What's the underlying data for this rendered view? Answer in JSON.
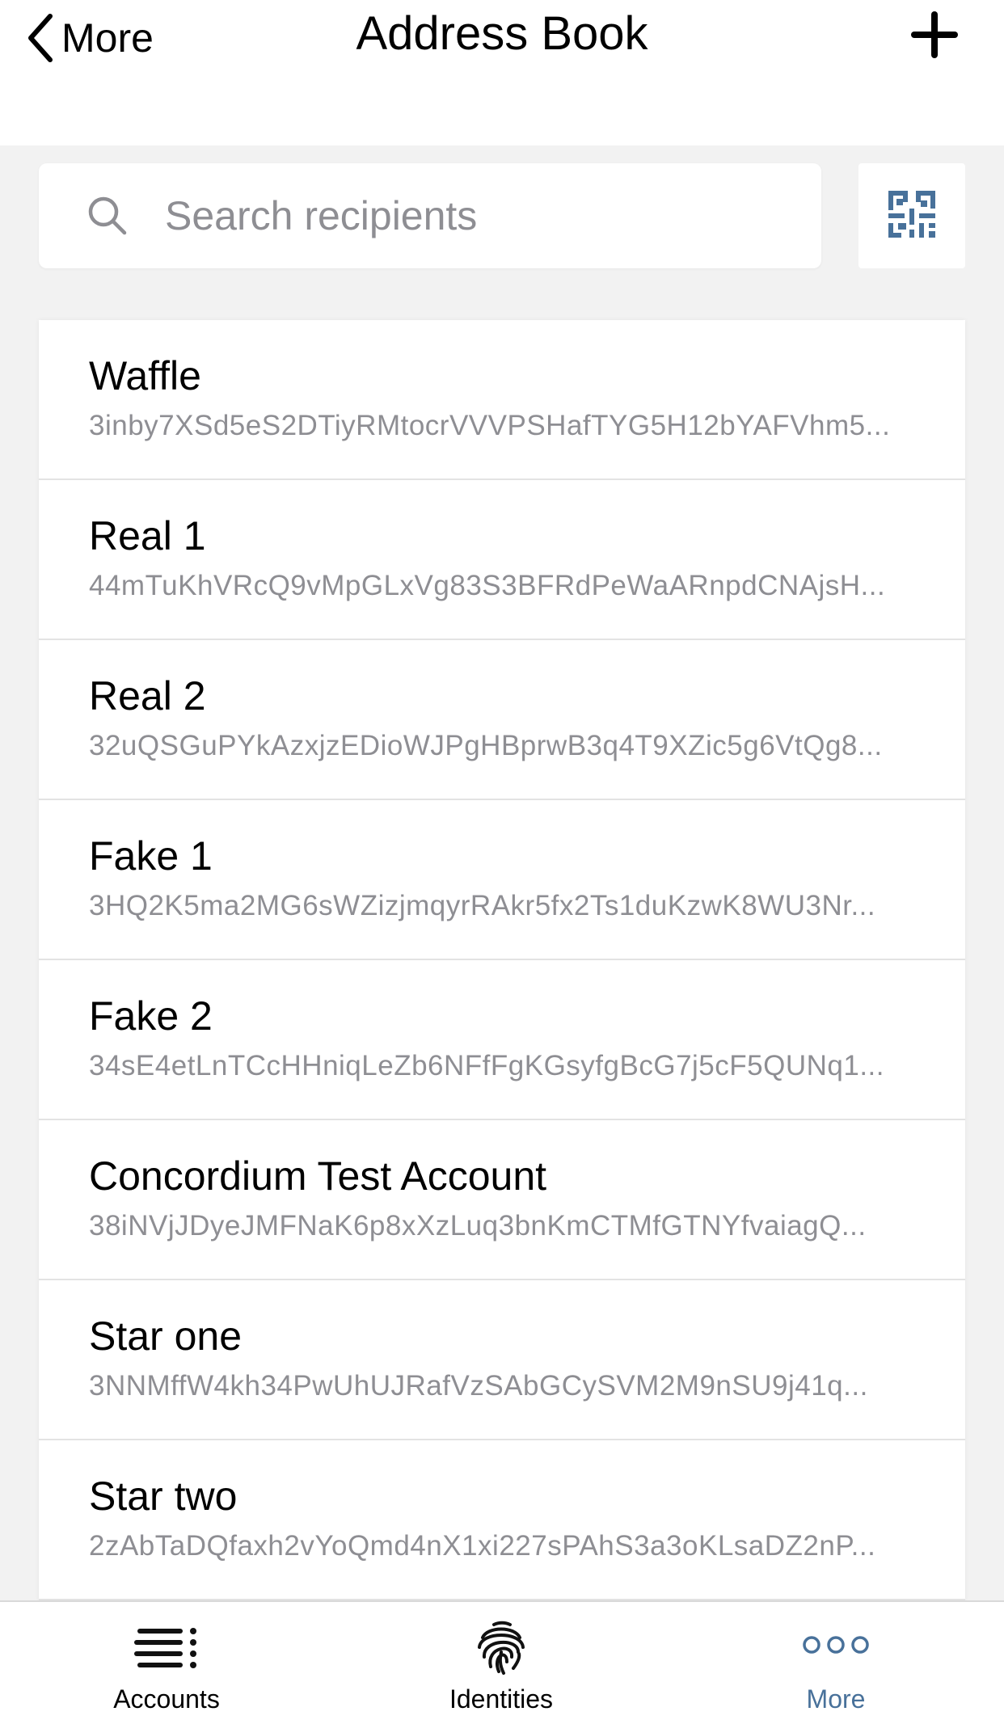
{
  "header": {
    "back_label": "More",
    "title": "Address Book"
  },
  "search": {
    "placeholder": "Search recipients"
  },
  "recipients": [
    {
      "name": "Waffle",
      "address": "3inby7XSd5eS2DTiyRMtocrVVVPSHafTYG5H12bYAFVhm5..."
    },
    {
      "name": "Real 1",
      "address": "44mTuKhVRcQ9vMpGLxVg83S3BFRdPeWaARnpdCNAjsH..."
    },
    {
      "name": "Real 2",
      "address": "32uQSGuPYkAzxjzEDioWJPgHBprwB3q4T9XZic5g6VtQg8..."
    },
    {
      "name": "Fake 1",
      "address": "3HQ2K5ma2MG6sWZizjmqyrRAkr5fx2Ts1duKzwK8WU3Nr..."
    },
    {
      "name": "Fake 2",
      "address": "34sE4etLnTCcHHniqLeZb6NFfFgKGsyfgBcG7j5cF5QUNq1..."
    },
    {
      "name": "Concordium Test Account",
      "address": "38iNVjJDyeJMFNaK6p8xXzLuq3bnKmCTMfGTNYfvaiagQ..."
    },
    {
      "name": "Star one",
      "address": "3NNMffW4kh34PwUhUJRafVzSAbGCySVM2M9nSU9j41q..."
    },
    {
      "name": "Star two",
      "address": "2zAbTaDQfaxh2vYoQmd4nX1xi227sPAhS3a3oKLsaDZ2nP..."
    }
  ],
  "tabs": [
    {
      "label": "Accounts",
      "icon": "accounts-list-icon",
      "active": false
    },
    {
      "label": "Identities",
      "icon": "fingerprint-icon",
      "active": false
    },
    {
      "label": "More",
      "icon": "more-dots-icon",
      "active": true
    }
  ],
  "colors": {
    "accent": "#48719a",
    "secondary_text": "#8e8e93",
    "background": "#f2f2f2"
  }
}
